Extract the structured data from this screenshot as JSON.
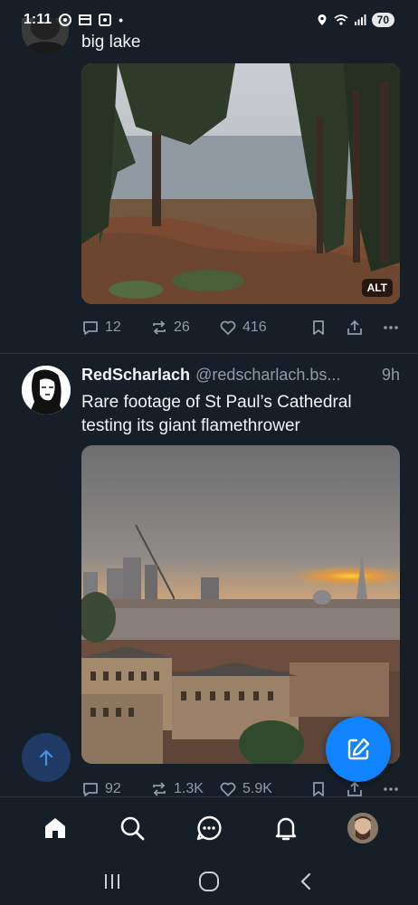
{
  "status_bar": {
    "time": "1:11",
    "battery": "70",
    "dot": "•"
  },
  "post1": {
    "text": "big lake",
    "alt_badge": "ALT",
    "replies": "12",
    "reposts": "26",
    "likes": "416"
  },
  "post2": {
    "author_name": "RedScharlach",
    "author_handle": "@redscharlach.bs...",
    "time": "9h",
    "text": "Rare footage of St Paul’s Cathedral testing its giant flamethrower",
    "replies": "92",
    "reposts": "1.3K",
    "likes": "5.9K"
  },
  "colors": {
    "background": "#161e27",
    "accent": "#1083fe",
    "muted": "#8e9bab"
  },
  "icons": {
    "reply": "speech-bubble-icon",
    "repost": "repost-arrows-icon",
    "like": "heart-icon",
    "bookmark": "bookmark-icon",
    "share": "share-icon",
    "more": "more-dots-icon"
  }
}
